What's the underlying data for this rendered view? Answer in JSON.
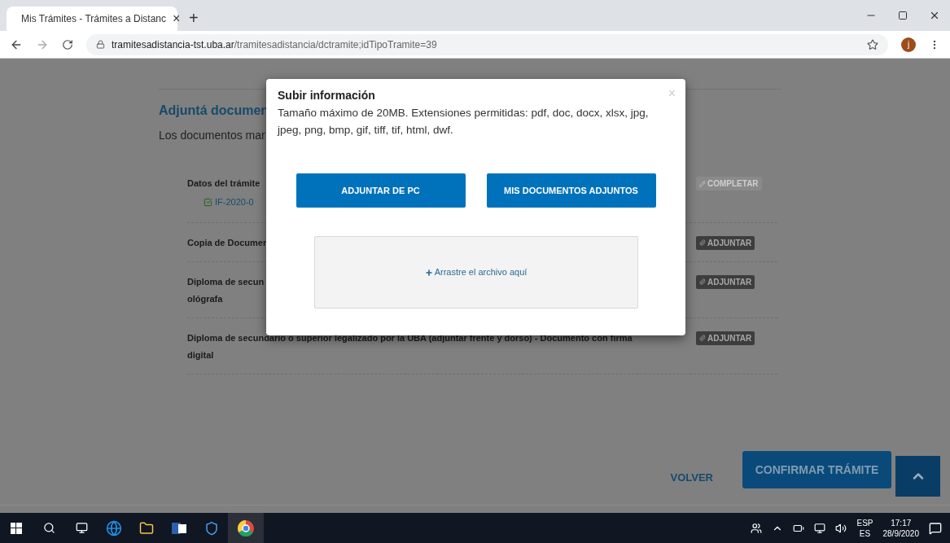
{
  "browser": {
    "tab": {
      "title": "Mis Trámites - Trámites a Distanc",
      "close": "×"
    },
    "new_tab": "+",
    "address": {
      "host": "tramitesadistancia-tst.uba.ar",
      "path": "/tramitesadistancia/dctramite;idTipoTramite=39"
    },
    "profile_initial": "j"
  },
  "page": {
    "heading": "Adjuntá documen",
    "subtitle": "Los documentos mar",
    "documents": [
      {
        "kind": "form",
        "lines": [
          "Datos del trámite"
        ],
        "file": "IF-2020-0",
        "action": "COMPLETAR",
        "disabled": true
      },
      {
        "kind": "upload",
        "lines": [
          "Copia de Documen"
        ],
        "action": "ADJUNTAR",
        "disabled": false
      },
      {
        "kind": "upload",
        "lines": [
          "Diploma de secun",
          "ológrafa"
        ],
        "action": "ADJUNTAR",
        "disabled": false
      },
      {
        "kind": "upload",
        "lines": [
          "Diploma de secundario o superior legalizado por la UBA (adjuntar frente y dorso) - Documento con firma",
          "digital"
        ],
        "action": "ADJUNTAR",
        "disabled": false
      }
    ],
    "back": "VOLVER",
    "confirm": "CONFIRMAR TRÁMITE"
  },
  "modal": {
    "title": "Subir información",
    "description": "Tamaño máximo de 20MB. Extensiones permitidas: pdf, doc, docx, xlsx, jpg, jpeg, png, bmp, gif, tiff, tif, html, dwf.",
    "close": "×",
    "buttons": [
      "ADJUNTAR DE PC",
      "MIS DOCUMENTOS ADJUNTOS"
    ],
    "dropzone": "Arrastre el archivo aquí"
  },
  "taskbar": {
    "tray": {
      "language": "ESP",
      "layout": "ES",
      "time": "17:17",
      "date": "28/9/2020"
    }
  }
}
